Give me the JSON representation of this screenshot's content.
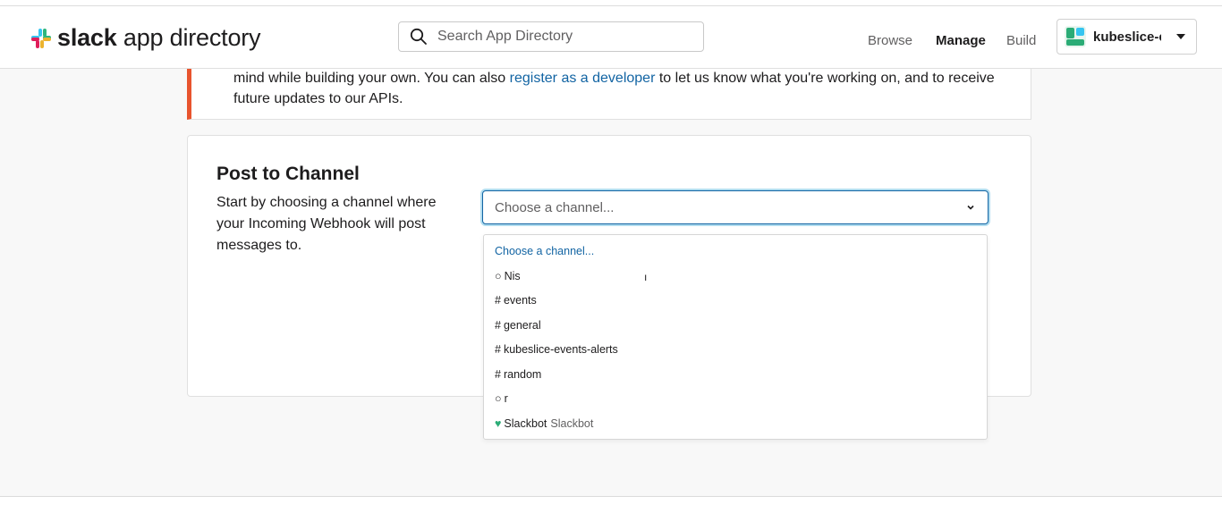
{
  "header": {
    "logo_bold": "slack",
    "logo_rest": " app directory",
    "search_placeholder": "Search App Directory",
    "nav": {
      "browse": "Browse",
      "manage": "Manage",
      "build": "Build"
    },
    "workspace": "kubeslice-events"
  },
  "notice": {
    "text_before": "mind while building your own. You can also ",
    "link": "register as a developer",
    "text_after": " to let us know what you're working on, and to receive future updates to our APIs."
  },
  "card": {
    "title": "Post to Channel",
    "description": "Start by choosing a channel where your Incoming Webhook will post messages to."
  },
  "select": {
    "value": "Choose a channel...",
    "options": [
      {
        "prefix": "",
        "label": "Choose a channel..."
      },
      {
        "prefix": "○",
        "label": "Nis"
      },
      {
        "prefix": "#",
        "label": "events"
      },
      {
        "prefix": "#",
        "label": "general"
      },
      {
        "prefix": "#",
        "label": "kubeslice-events-alerts"
      },
      {
        "prefix": "#",
        "label": "random"
      },
      {
        "prefix": "○",
        "label": "r"
      },
      {
        "prefix": "♥",
        "label": "Slackbot",
        "sub": "Slackbot"
      }
    ]
  },
  "colors": {
    "accent_link": "#1264a3",
    "notice_bar": "#e8542e",
    "slackbot_heart": "#2bac76"
  }
}
